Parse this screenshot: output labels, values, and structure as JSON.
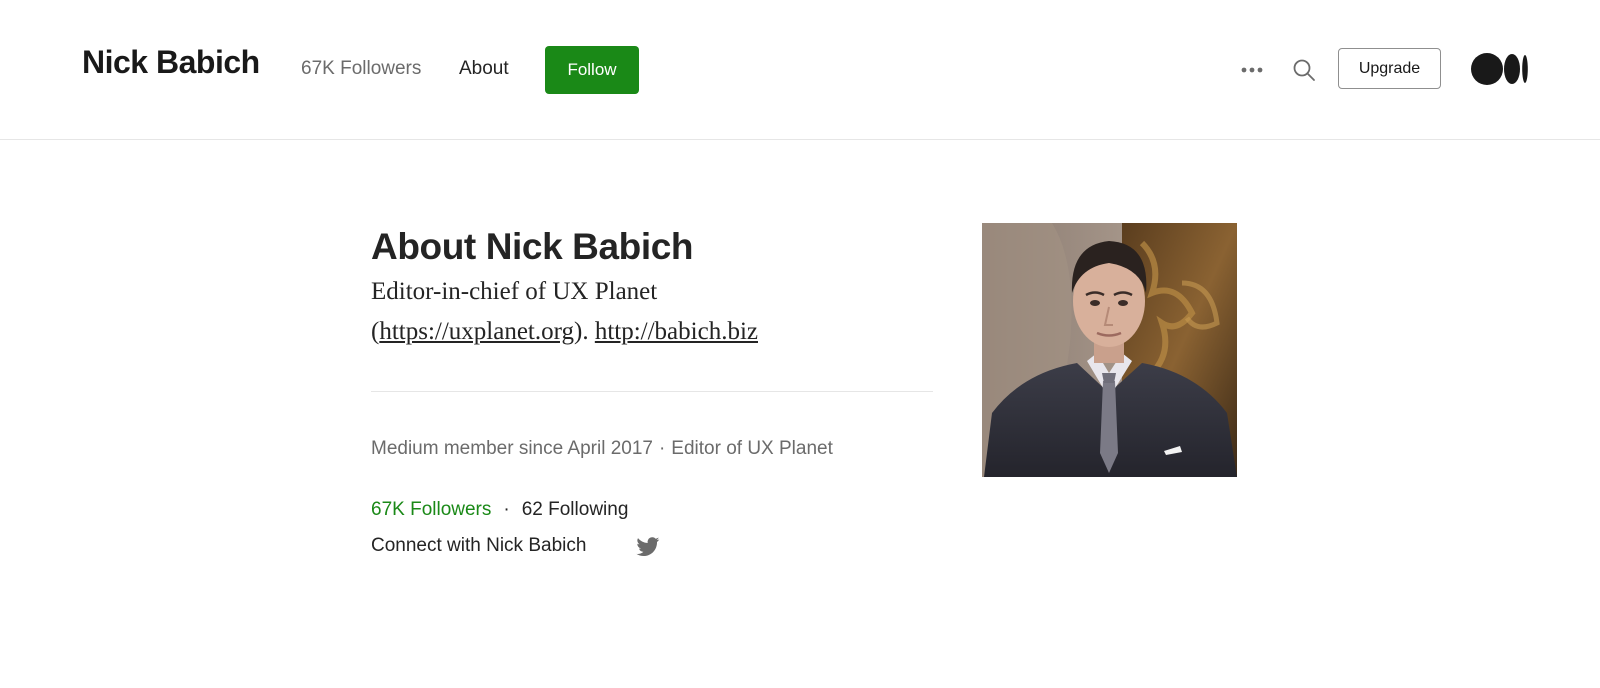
{
  "header": {
    "brand": "Nick Babich",
    "followers": "67K Followers",
    "about": "About",
    "follow": "Follow",
    "upgrade": "Upgrade",
    "icons": [
      "more-icon",
      "search-icon",
      "medium-logo-icon"
    ]
  },
  "main": {
    "title": "About Nick Babich",
    "bio_line1": "Editor-in-chief of UX Planet",
    "bio_open_paren": "(",
    "bio_link1": "https://uxplanet.org",
    "bio_close": ").",
    "bio_link2": "http://babich.biz",
    "member_since": "Medium member since April 2017",
    "meta_separator": "·",
    "editor_of": "Editor of UX Planet",
    "followers": "67K Followers",
    "stats_separator": "·",
    "following": "62 Following",
    "connect": "Connect with Nick Babich",
    "twitter_icon": "twitter-icon"
  },
  "colors": {
    "accent_green": "#1a8917",
    "text": "#242424",
    "muted": "#6b6b6b",
    "divider": "#e6e6e6"
  }
}
